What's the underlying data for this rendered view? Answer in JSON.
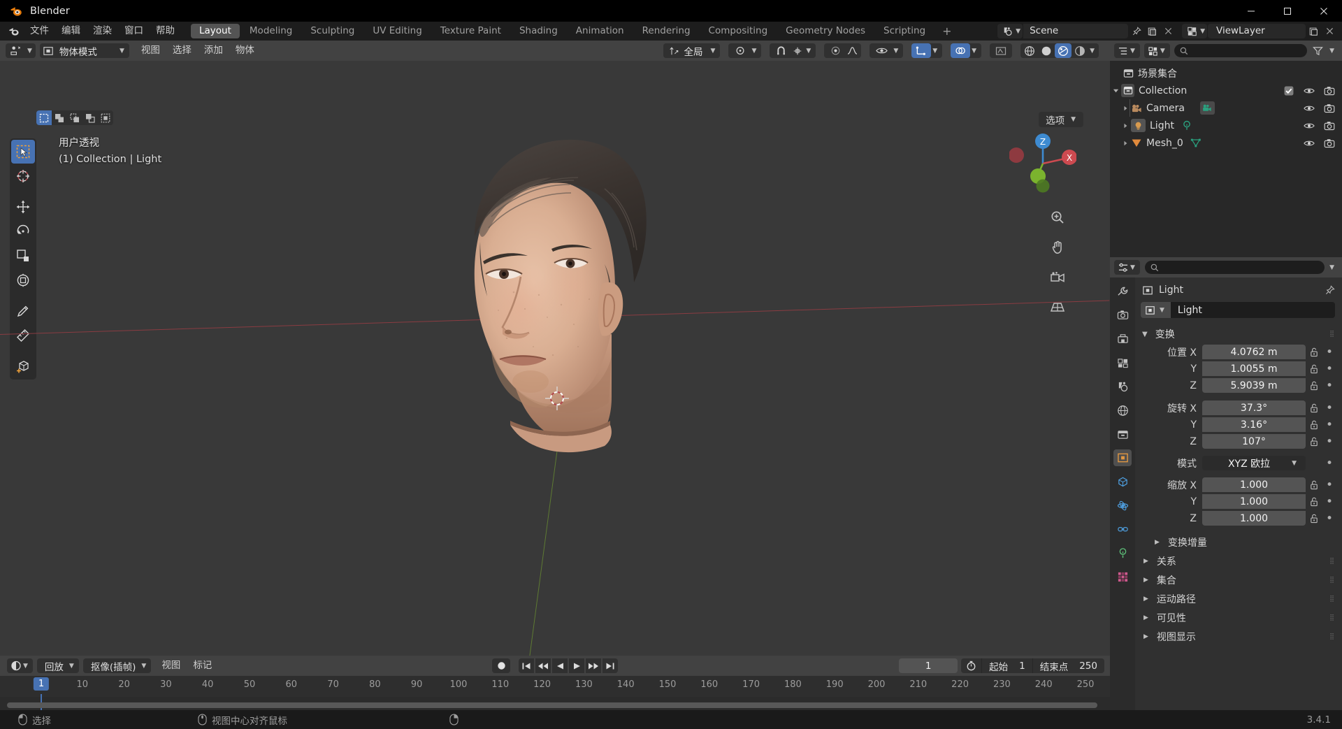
{
  "window": {
    "title": "Blender",
    "app_icon": "blender-logo-icon",
    "minimize": "—",
    "maximize": "☐",
    "close": "✕"
  },
  "topbar": {
    "menus": [
      "文件",
      "编辑",
      "渲染",
      "窗口",
      "帮助"
    ],
    "tabs": [
      {
        "label": "Layout",
        "active": true
      },
      {
        "label": "Modeling",
        "active": false
      },
      {
        "label": "Sculpting",
        "active": false
      },
      {
        "label": "UV Editing",
        "active": false
      },
      {
        "label": "Texture Paint",
        "active": false
      },
      {
        "label": "Shading",
        "active": false
      },
      {
        "label": "Animation",
        "active": false
      },
      {
        "label": "Rendering",
        "active": false
      },
      {
        "label": "Compositing",
        "active": false
      },
      {
        "label": "Geometry Nodes",
        "active": false
      },
      {
        "label": "Scripting",
        "active": false
      }
    ],
    "add_tab": "+",
    "scene_name": "Scene",
    "view_layer_name": "ViewLayer"
  },
  "viewport": {
    "mode": "物体模式",
    "menus": [
      "视图",
      "选择",
      "添加",
      "物体"
    ],
    "transform_orientation": "全局",
    "options_label": "选项",
    "overlay_line1": "用户透视",
    "overlay_line2": "(1) Collection | Light",
    "gizmo_axes": {
      "x": "X",
      "y": "Y",
      "z": "Z"
    }
  },
  "timeline": {
    "editor_menu": "回放",
    "keying_menu": "抠像(插帧)",
    "menus": [
      "视图",
      "标记"
    ],
    "current_frame": "1",
    "start_label": "起始",
    "start_value": "1",
    "end_label": "结束点",
    "end_value": "250",
    "ticks": [
      "1",
      "10",
      "20",
      "30",
      "40",
      "50",
      "60",
      "70",
      "80",
      "90",
      "100",
      "110",
      "120",
      "130",
      "140",
      "150",
      "160",
      "170",
      "180",
      "190",
      "200",
      "210",
      "220",
      "230",
      "240",
      "250"
    ],
    "playhead_frame": "1"
  },
  "outliner": {
    "scene_collection": "场景集合",
    "rows": [
      {
        "label": "Collection",
        "icon": "collection-icon",
        "indent": 1,
        "expanded": true,
        "checkbox": true,
        "eye": true,
        "camera": true,
        "type_icon": ""
      },
      {
        "label": "Camera",
        "icon": "camera-data-icon",
        "indent": 2,
        "expanded": false,
        "checkbox": false,
        "eye": true,
        "camera": true,
        "type_icon": "camera-object-icon"
      },
      {
        "label": "Light",
        "icon": "light-object-icon",
        "indent": 2,
        "expanded": false,
        "checkbox": false,
        "eye": true,
        "camera": true,
        "type_icon": "light-data-icon"
      },
      {
        "label": "Mesh_0",
        "icon": "mesh-object-icon",
        "indent": 2,
        "expanded": false,
        "checkbox": false,
        "eye": true,
        "camera": true,
        "type_icon": "mesh-data-icon"
      }
    ]
  },
  "properties": {
    "breadcrumb_object": "Light",
    "name_field_value": "Light",
    "transform_panel": "变换",
    "rows": [
      {
        "label": "位置 X",
        "value": "4.0762 m",
        "pos": "top"
      },
      {
        "label": "Y",
        "value": "1.0055 m",
        "pos": "mid"
      },
      {
        "label": "Z",
        "value": "5.9039 m",
        "pos": "bot"
      },
      {
        "label": "旋转 X",
        "value": "37.3°",
        "pos": "top"
      },
      {
        "label": "Y",
        "value": "3.16°",
        "pos": "mid"
      },
      {
        "label": "Z",
        "value": "107°",
        "pos": "bot"
      }
    ],
    "mode_label": "模式",
    "mode_value": "XYZ 欧拉",
    "scale_rows": [
      {
        "label": "缩放 X",
        "value": "1.000",
        "pos": "top"
      },
      {
        "label": "Y",
        "value": "1.000",
        "pos": "mid"
      },
      {
        "label": "Z",
        "value": "1.000",
        "pos": "bot"
      }
    ],
    "delta_panel": "变换增量",
    "collapsed_panels": [
      "关系",
      "集合",
      "运动路径",
      "可见性",
      "视图显示"
    ],
    "tabs": [
      {
        "name": "tool-tab",
        "active": false
      },
      {
        "name": "render-tab",
        "active": false
      },
      {
        "name": "output-tab",
        "active": false
      },
      {
        "name": "view-layer-tab",
        "active": false
      },
      {
        "name": "scene-tab",
        "active": false
      },
      {
        "name": "world-tab",
        "active": false
      },
      {
        "name": "collection-tab",
        "active": false
      },
      {
        "name": "object-tab",
        "active": true
      },
      {
        "name": "modifier-tab",
        "active": false
      },
      {
        "name": "physics-tab",
        "active": false
      },
      {
        "name": "constraint-tab",
        "active": false
      },
      {
        "name": "data-tab",
        "active": false
      },
      {
        "name": "texture-tab",
        "active": false
      }
    ]
  },
  "statusbar": {
    "mouse_left_action": "选择",
    "mouse_middle_action": "视图中心对齐鼠标",
    "version": "3.4.1"
  },
  "colors": {
    "accent_blue": "#4772b3",
    "header_gray": "#424242",
    "panel_bg": "#303030",
    "viewport_bg": "#393939",
    "outliner_bg": "#282828",
    "field_gray": "#545454",
    "axis_x_red": "#cd4a50",
    "axis_y_green": "#7bb32e",
    "axis_z_blue": "#3e8bd1",
    "orange": "#e87d0d"
  }
}
